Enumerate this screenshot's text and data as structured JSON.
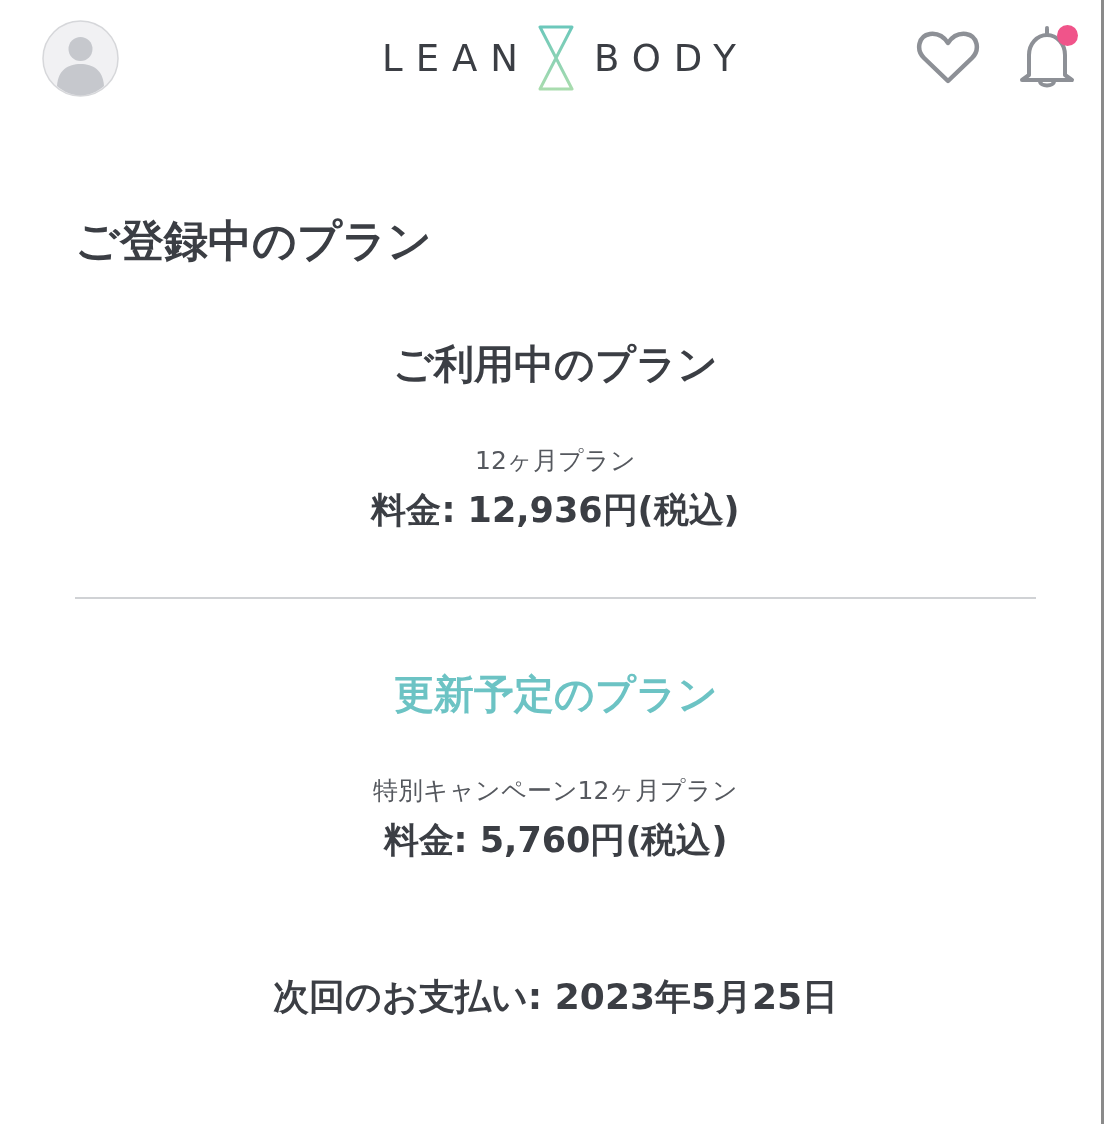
{
  "header": {
    "logo": {
      "left": "LEAN",
      "right": "BODY"
    },
    "notifications": {
      "unread": true
    }
  },
  "page_title": "ご登録中のプラン",
  "plans": [
    {
      "kind": "current",
      "heading": "ご利用中のプラン",
      "name": "12ヶ月プラン",
      "price": "料金: 12,936円(税込)"
    },
    {
      "kind": "upcoming",
      "heading": "更新予定のプラン",
      "name": "特別キャンペーン12ヶ月プラン",
      "price": "料金: 5,760円(税込)"
    }
  ],
  "next_payment": "次回のお支払い: 2023年5月25日"
}
